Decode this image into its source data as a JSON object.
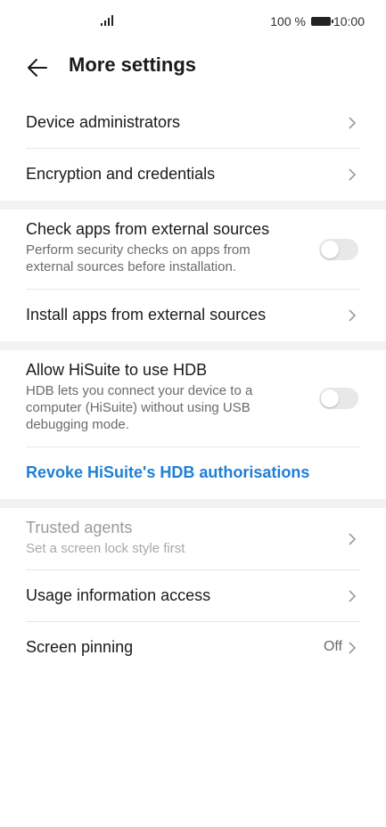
{
  "status_bar": {
    "battery": "100 %",
    "time": "10:00"
  },
  "header": {
    "title": "More settings"
  },
  "section1": {
    "device_admins": "Device administrators",
    "encryption": "Encryption and credentials"
  },
  "section2": {
    "check_apps_title": "Check apps from external sources",
    "check_apps_sub": "Perform security checks on apps from external sources before installation.",
    "check_apps_enabled": false,
    "install_apps": "Install apps from external sources"
  },
  "section3": {
    "hdb_title": "Allow HiSuite to use HDB",
    "hdb_sub": "HDB lets you connect your device to a computer (HiSuite) without using USB debugging mode.",
    "hdb_enabled": false,
    "revoke_link": "Revoke HiSuite's HDB authorisations"
  },
  "section4": {
    "trusted_agents_title": "Trusted agents",
    "trusted_agents_sub": "Set a screen lock style first",
    "usage_access": "Usage information access",
    "screen_pinning": "Screen pinning",
    "screen_pinning_value": "Off"
  },
  "colors": {
    "accent": "#1f7fd6",
    "separator_band": "#f2f2f2",
    "toggle_off": "#e8e8e8"
  }
}
